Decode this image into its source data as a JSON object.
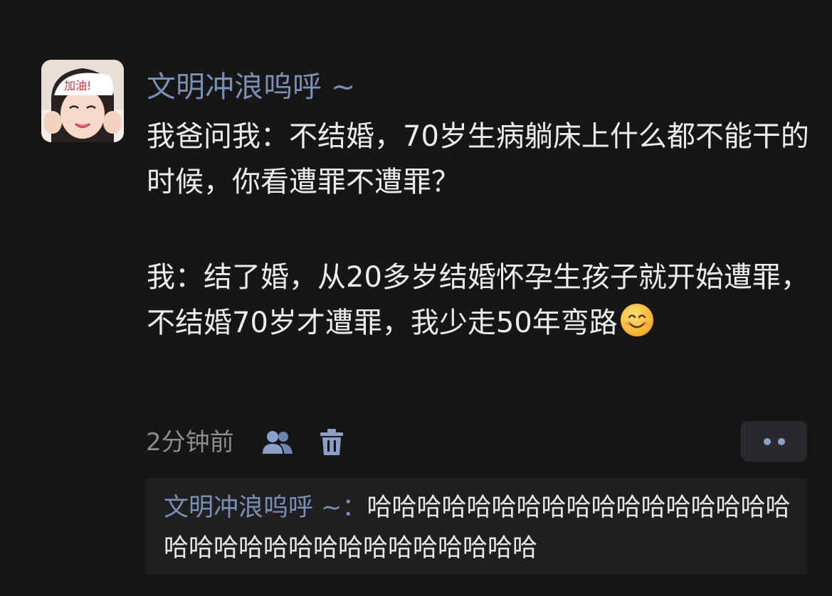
{
  "post": {
    "author": "文明冲浪呜呼 ~",
    "avatar_icon": "avatar-girl-icon",
    "paragraphs": [
      "我爸问我：不结婚，70岁生病躺床上什么都不能干的时候，你看遭罪不遭罪？",
      "我：结了婚，从20多岁结婚怀孕生孩子就开始遭罪，不结婚70岁才遭罪，我少走50年弯路"
    ],
    "emoji": "smiling-face-icon",
    "time": "2分钟前"
  },
  "actions": {
    "friends_icon": "friends-visibility-icon",
    "delete_icon": "trash-icon",
    "more_icon": "more-dots-icon"
  },
  "comments": [
    {
      "user": "文明冲浪呜呼 ~",
      "separator": "：",
      "text": "哈哈哈哈哈哈哈哈哈哈哈哈哈哈哈哈哈哈哈哈哈哈哈哈哈哈哈哈哈哈哈哈"
    }
  ],
  "colors": {
    "background": "#161617",
    "username": "#7a8fb3",
    "text": "#ececec",
    "meta": "#8b8b90",
    "icon": "#8aa0c8",
    "comment_bg": "#1f1f22"
  }
}
